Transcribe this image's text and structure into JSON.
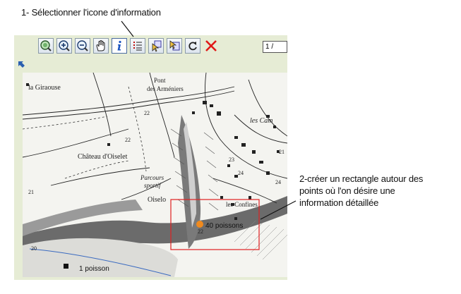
{
  "annotations": {
    "step1": "1- Sélectionner l'icone d'information",
    "step2": "2-créer un rectangle autour des points où l'on désire une information détaillée"
  },
  "toolbar": {
    "buttons": [
      {
        "name": "zoom-full-extent",
        "icon": "globe-zoom-icon"
      },
      {
        "name": "zoom-in",
        "icon": "zoom-in-icon"
      },
      {
        "name": "zoom-out",
        "icon": "zoom-out-icon"
      },
      {
        "name": "pan",
        "icon": "hand-icon"
      },
      {
        "name": "identify",
        "icon": "info-icon",
        "active": true
      },
      {
        "name": "legend",
        "icon": "list-icon"
      },
      {
        "name": "select-layer-1",
        "icon": "layer-select-icon"
      },
      {
        "name": "select-layer-2",
        "icon": "layer-pointer-icon"
      },
      {
        "name": "refresh",
        "icon": "refresh-icon"
      },
      {
        "name": "clear",
        "icon": "close-icon"
      }
    ],
    "scale_value": "1 /"
  },
  "map": {
    "places": [
      {
        "id": "la-giraouse",
        "label": "la Giraouse"
      },
      {
        "id": "pont",
        "label": "Pont"
      },
      {
        "id": "des-armeniers",
        "label": "des Arméniers"
      },
      {
        "id": "les-cam",
        "label": "les Cam"
      },
      {
        "id": "chateau",
        "label": "Château d'Oiselet"
      },
      {
        "id": "parcours",
        "label": "Parcours"
      },
      {
        "id": "sportif",
        "label": "sportif"
      },
      {
        "id": "oiselo",
        "label": "Oiselo"
      },
      {
        "id": "les-confines",
        "label": "les Confines"
      }
    ],
    "elevations": [
      "22",
      "22",
      "23",
      "24",
      "21",
      "22",
      "20",
      "21",
      "24"
    ],
    "points": [
      {
        "label": "40 poissons",
        "color": "#f08a1e"
      },
      {
        "label": "1 poisson",
        "color": "#111111"
      }
    ],
    "selection_rect_color": "#e02020"
  }
}
